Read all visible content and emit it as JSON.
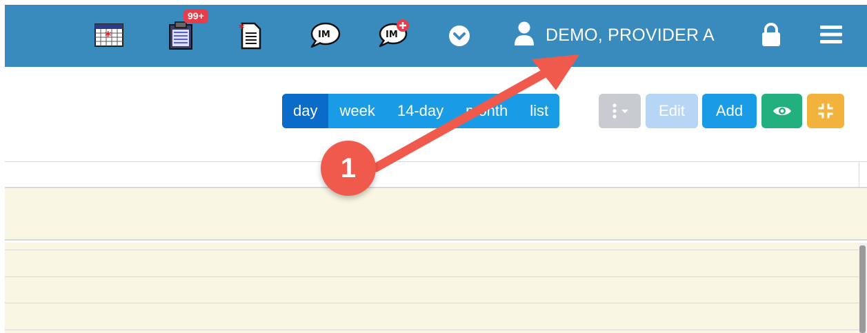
{
  "topbar": {
    "icons": [
      {
        "name": "calendar-icon"
      },
      {
        "name": "clipboard-icon",
        "badge": "99+"
      },
      {
        "name": "new-document-icon"
      },
      {
        "name": "im-chat-icon",
        "label": "IM"
      },
      {
        "name": "im-chat-add-icon",
        "label": "IM"
      },
      {
        "name": "chevron-down-circle-icon"
      }
    ],
    "user": {
      "name": "DEMO, PROVIDER A",
      "icon": "user-icon"
    },
    "lock_icon": "lock-icon",
    "menu_icon": "hamburger-menu-icon",
    "colors": {
      "bar": "#3a8bbd",
      "badge": "#e53e4b"
    }
  },
  "toolbar": {
    "views": [
      {
        "label": "day",
        "active": true
      },
      {
        "label": "week",
        "active": false
      },
      {
        "label": "14-day",
        "active": false
      },
      {
        "label": "month",
        "active": false
      },
      {
        "label": "list",
        "active": false
      }
    ],
    "edit_label": "Edit",
    "add_label": "Add",
    "more_icon": "vertical-ellipsis-icon",
    "eye_icon": "eye-icon",
    "compress_icon": "compress-icon",
    "colors": {
      "primary": "#1a9be6",
      "active": "#0b6bc8",
      "gray": "#c8ccd0",
      "edit": "#b7d6f5",
      "green": "#22b07f",
      "orange": "#f2b33d"
    }
  },
  "annotation": {
    "label": "1",
    "color": "#f05a4c"
  }
}
